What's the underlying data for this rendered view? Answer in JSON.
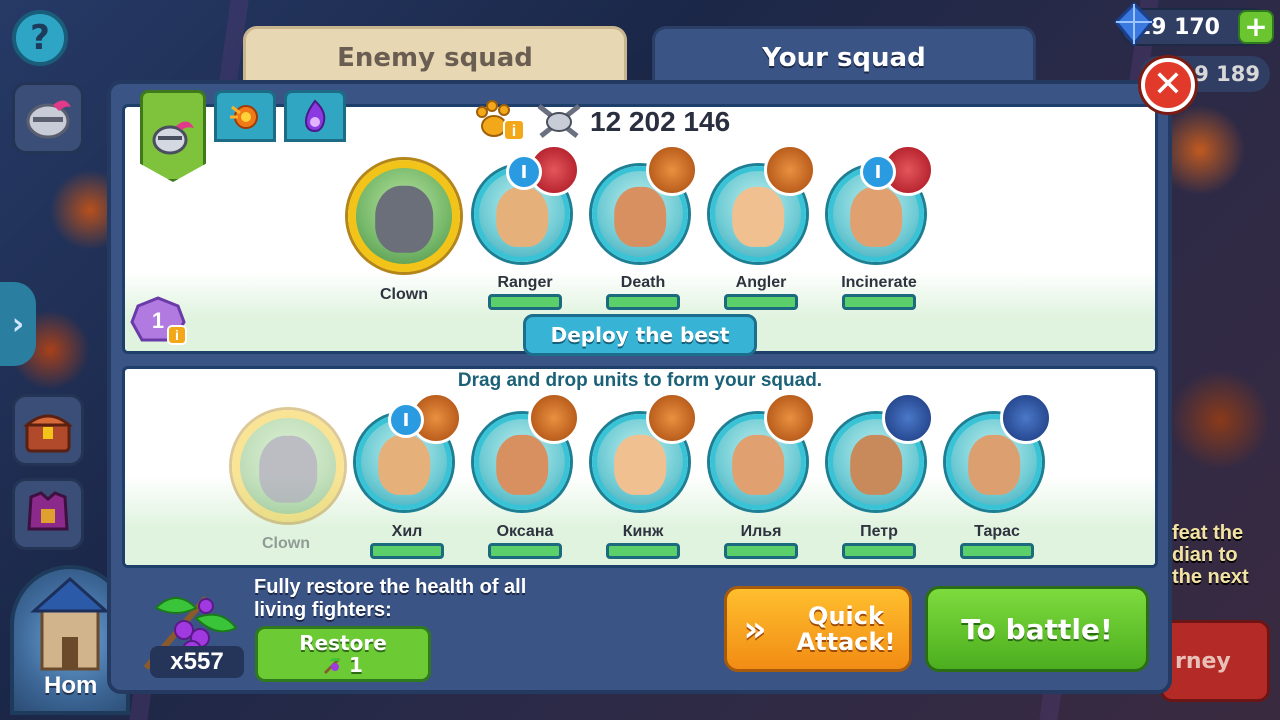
{
  "tabs": {
    "enemy": "Enemy squad",
    "your": "Your squad"
  },
  "hud": {
    "gems": "19 170",
    "gold": "99 189"
  },
  "side": {
    "help": "?",
    "home": "Hom",
    "promo_text": "feat the\ndian to\nthe next",
    "journey": "rney"
  },
  "power": {
    "value": "12 202 146"
  },
  "squad": {
    "leader": {
      "name": "Clown"
    },
    "units": [
      {
        "name": "Ranger",
        "badge": "red",
        "rank": "I"
      },
      {
        "name": "Death",
        "badge": "orange",
        "rank": ""
      },
      {
        "name": "Angler",
        "badge": "orange",
        "rank": ""
      },
      {
        "name": "Incinerate",
        "badge": "red",
        "rank": "I"
      }
    ],
    "level": "1",
    "deploy_label": "Deploy the best"
  },
  "reserve": {
    "hint": "Drag and drop units to form your squad.",
    "leader": {
      "name": "Clown"
    },
    "units": [
      {
        "name": "Хил",
        "badge": "orange",
        "rank": "I"
      },
      {
        "name": "Оксана",
        "badge": "orange",
        "rank": ""
      },
      {
        "name": "Кинж",
        "badge": "orange",
        "rank": ""
      },
      {
        "name": "Илья",
        "badge": "orange",
        "rank": ""
      },
      {
        "name": "Петр",
        "badge": "blue",
        "rank": ""
      },
      {
        "name": "Тарас",
        "badge": "blue",
        "rank": ""
      }
    ]
  },
  "restore": {
    "potion_count": "x557",
    "text": "Fully restore the health of all living fighters:",
    "button_label": "Restore",
    "cost": "1"
  },
  "actions": {
    "quick_attack": "Quick Attack!",
    "to_battle": "To battle!"
  },
  "colors": {
    "gold_frame": "#f2c419",
    "unit_frame": "#38c3d6",
    "hp_green": "#5bd06a",
    "battle_green": "#6ccb34",
    "quick_orange": "#f18c14"
  }
}
